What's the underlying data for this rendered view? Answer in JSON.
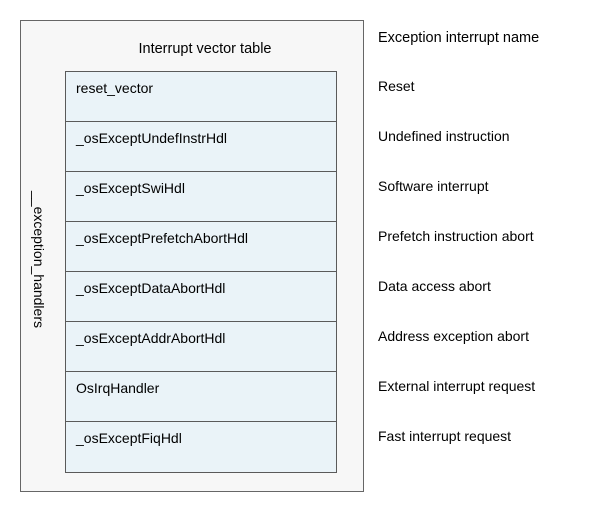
{
  "diagram": {
    "tableTitle": "Interrupt vector table",
    "sideLabel": "__exception_handlers",
    "columnHeader": "Exception interrupt name",
    "rows": [
      {
        "handler": "reset_vector",
        "name": "Reset"
      },
      {
        "handler": "_osExceptUndefInstrHdl",
        "name": "Undefined instruction"
      },
      {
        "handler": "_osExceptSwiHdl",
        "name": "Software interrupt"
      },
      {
        "handler": "_osExceptPrefetchAbortHdl",
        "name": "Prefetch instruction abort"
      },
      {
        "handler": "_osExceptDataAbortHdl",
        "name": "Data access abort"
      },
      {
        "handler": "_osExceptAddrAbortHdl",
        "name": "Address exception abort"
      },
      {
        "handler": "OsIrqHandler",
        "name": "External interrupt request"
      },
      {
        "handler": "_osExceptFiqHdl",
        "name": "Fast interrupt request"
      }
    ]
  }
}
